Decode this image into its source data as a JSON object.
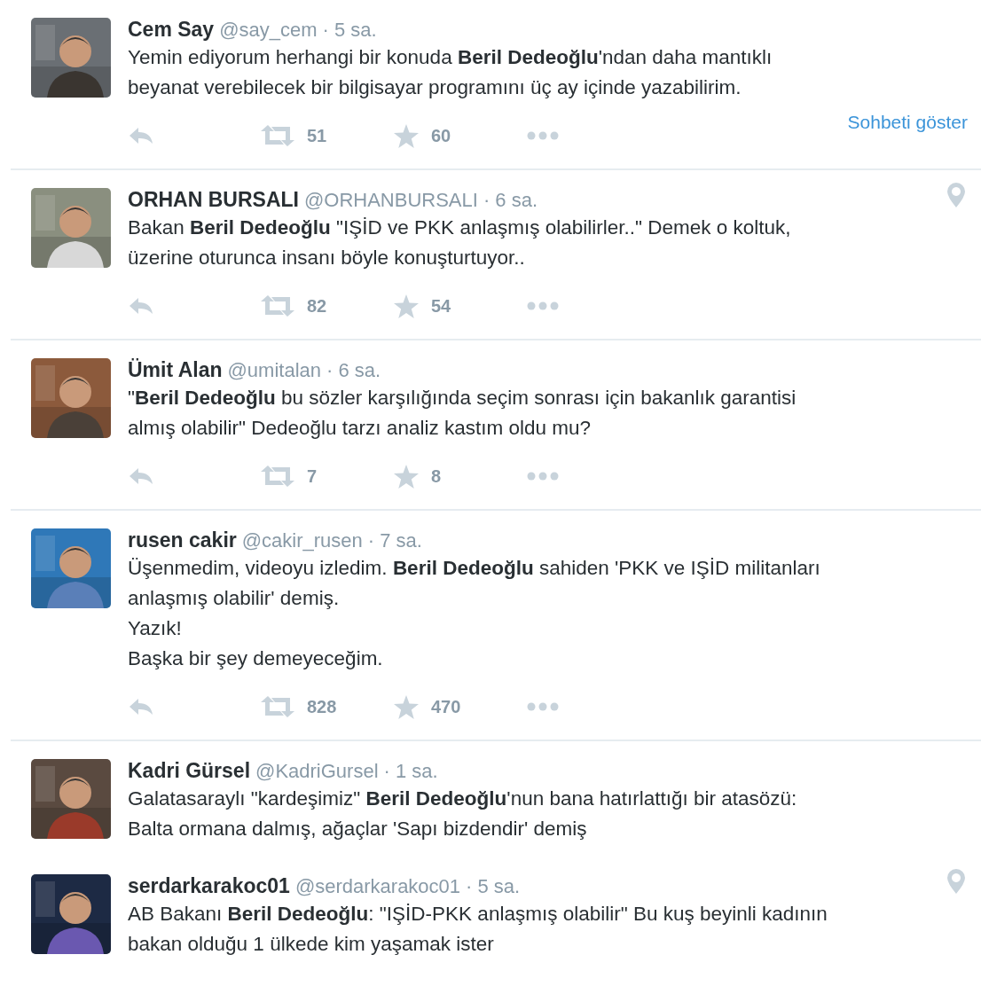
{
  "tweets": [
    {
      "name": "Cem Say",
      "handle": "@say_cem",
      "time": "· 5 sa.",
      "lines": [
        "Yemin ediyorum herhangi bir konuda **Beril Dedeoğlu**'ndan daha mantıklı",
        "beyanat verebilecek bir bilgisayar programını üç ay içinde yazabilirim."
      ],
      "location": false,
      "actions": {
        "retweets": "51",
        "favorites": "60"
      },
      "conversation_link": "Sohbeti göster"
    },
    {
      "name": "ORHAN BURSALI",
      "handle": "@ORHANBURSALI",
      "time": "· 6 sa.",
      "lines": [
        "Bakan **Beril Dedeoğlu** \"IŞİD ve PKK anlaşmış olabilirler..\" Demek o koltuk,",
        "üzerine oturunca insanı böyle konuşturtuyor.."
      ],
      "location": true,
      "actions": {
        "retweets": "82",
        "favorites": "54"
      }
    },
    {
      "name": "Ümit Alan",
      "handle": "@umitalan",
      "time": "· 6 sa.",
      "lines": [
        "\"**Beril Dedeoğlu** bu sözler karşılığında seçim sonrası için bakanlık garantisi",
        "almış olabilir\" Dedeoğlu tarzı analiz kastım oldu mu?"
      ],
      "location": false,
      "actions": {
        "retweets": "7",
        "favorites": "8"
      }
    },
    {
      "name": "rusen cakir",
      "handle": "@cakir_rusen",
      "time": "· 7 sa.",
      "lines": [
        "Üşenmedim, videoyu izledim. **Beril Dedeoğlu** sahiden 'PKK ve IŞİD militanları",
        "anlaşmış olabilir' demiş.",
        "Yazık!",
        "Başka bir şey demeyeceğim."
      ],
      "location": false,
      "actions": {
        "retweets": "828",
        "favorites": "470"
      }
    },
    {
      "name": "Kadri Gürsel",
      "handle": "@KadriGursel",
      "time": "· 1 sa.",
      "lines": [
        "Galatasaraylı \"kardeşimiz\" **Beril Dedeoğlu**'nun bana hatırlattığı bir atasözü:",
        "Balta ormana dalmış, ağaçlar 'Sapı bizdendir' demiş"
      ],
      "location": false
    },
    {
      "name": "serdarkarakoc01",
      "handle": "@serdarkarakoc01",
      "time": "· 5 sa.",
      "lines": [
        "AB Bakanı **Beril Dedeoğlu**: \"IŞİD-PKK anlaşmış olabilir\" Bu kuş beyinli kadının",
        "bakan olduğu 1 ülkede kim yaşamak ister"
      ],
      "location": true
    }
  ]
}
